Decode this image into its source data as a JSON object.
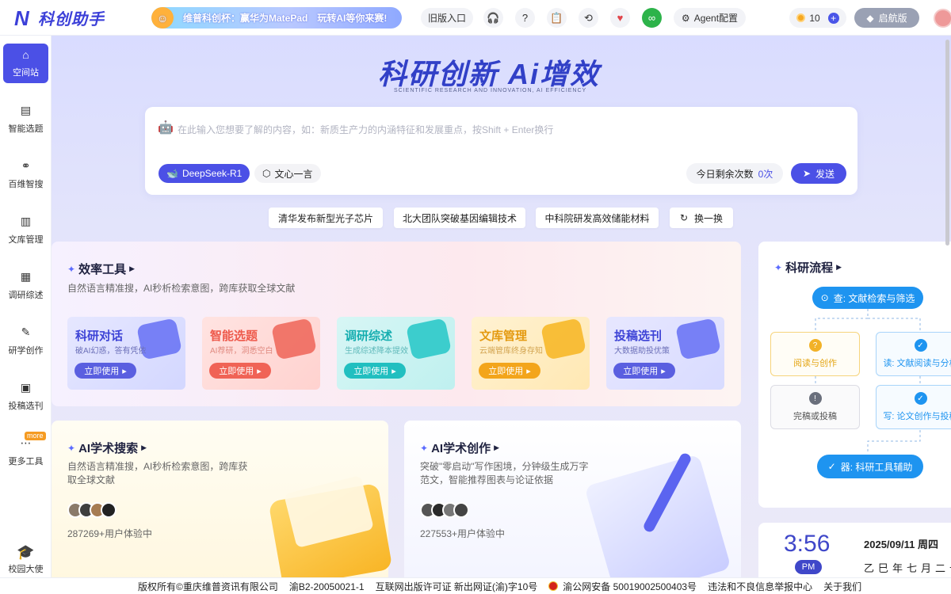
{
  "app": {
    "name": "科创助手"
  },
  "header": {
    "banner_parts": [
      "维普科创杯：",
      "赢华为MatePad",
      "玩转AI等你来赛!"
    ],
    "old_version": "旧版入口",
    "agent_config": "Agent配置",
    "coins": "10",
    "launch": "启航版",
    "icons": [
      "headset-icon",
      "help-icon",
      "task-icon",
      "history-icon",
      "heart-monitor-icon",
      "link-icon",
      "gear-icon"
    ]
  },
  "sidebar": {
    "items": [
      {
        "label": "空间站",
        "icon": "home-icon"
      },
      {
        "label": "智能选题",
        "icon": "clipboard-icon"
      },
      {
        "label": "百维智搜",
        "icon": "search-binoculars-icon"
      },
      {
        "label": "文库管理",
        "icon": "library-icon"
      },
      {
        "label": "调研综述",
        "icon": "book-icon"
      },
      {
        "label": "研学创作",
        "icon": "edit-icon"
      },
      {
        "label": "投稿选刊",
        "icon": "journal-icon"
      },
      {
        "label": "更多工具",
        "icon": "more-icon"
      }
    ],
    "more_badge": "more",
    "campus": "校园大使"
  },
  "hero": {
    "title": "科研创新 Ai增效",
    "subtitle": "SCIENTIFIC RESEARCH AND INNOVATION, AI EFFICIENCY"
  },
  "search": {
    "placeholder": "在此输入您想要了解的内容，如：新质生产力的内涵特征和发展重点，按Shift + Enter换行",
    "model_selected": "DeepSeek-R1",
    "model_alt": "文心一言",
    "quota_label": "今日剩余次数",
    "quota_value": "0次",
    "send": "发送"
  },
  "topics": [
    "清华发布新型光子芯片",
    "北大团队突破基因编辑技术",
    "中科院研发高效储能材料",
    "换一换"
  ],
  "efficiency": {
    "title": "效率工具",
    "desc": "自然语言精准搜，AI秒析检索意图，跨库获取全球文献",
    "tools": [
      {
        "title": "科研对话",
        "desc": "破AI幻惑，答有凭依",
        "btn": "立即使用",
        "color": "#5a5fe0"
      },
      {
        "title": "智能选题",
        "desc": "AI荐研，洞悉空白",
        "btn": "立即使用",
        "color": "#f06356"
      },
      {
        "title": "调研综述",
        "desc": "生成综述降本提效",
        "btn": "立即使用",
        "color": "#21bfc0"
      },
      {
        "title": "文库管理",
        "desc": "云端管库终身存知",
        "btn": "立即使用",
        "color": "#f3a51b"
      },
      {
        "title": "投稿选刊",
        "desc": "大数据助投优策",
        "btn": "立即使用",
        "color": "#5a5fe0"
      }
    ]
  },
  "ai_search": {
    "title": "AI学术搜索",
    "desc": "自然语言精准搜，AI秒析检索意图，跨库获取全球文献",
    "users": "287269+用户体验中"
  },
  "ai_write": {
    "title": "AI学术创作",
    "desc": "突破\"零启动\"写作困境，分钟级生成万字范文，智能推荐图表与论证依据",
    "users": "227553+用户体验中"
  },
  "flow": {
    "title": "科研流程",
    "top": "查: 文献检索与筛选",
    "read_create": "阅读与创作",
    "read": "读: 文献阅读与分析",
    "finish": "完稿或投稿",
    "write": "写: 论文创作与投稿",
    "tool": "器: 科研工具辅助"
  },
  "clock": {
    "time": "3:56",
    "ampm": "PM",
    "date": "2025/09/11 周四",
    "lunar": "乙巳年七月二十"
  },
  "footer": {
    "items": [
      "版权所有©重庆维普资讯有限公司",
      "渝B2-20050021-1",
      "互联网出版许可证 新出网证(渝)字10号",
      "渝公网安备 50019002500403号",
      "违法和不良信息举报中心",
      "关于我们"
    ]
  }
}
